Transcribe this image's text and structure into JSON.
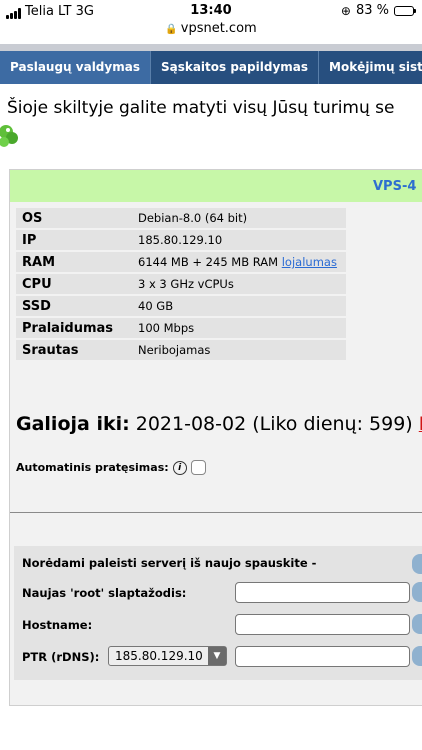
{
  "status_bar": {
    "carrier": "Telia LT 3G",
    "time": "13:40",
    "battery": "83 %",
    "battery_level": 0.83,
    "url": "vpsnet.com"
  },
  "nav": {
    "tabs": [
      {
        "label": "Paslaugų valdymas"
      },
      {
        "label": "Sąskaitos papildymas"
      },
      {
        "label": "Mokėjimų siste"
      }
    ]
  },
  "intro_text": "Šioje skiltyje galite matyti visų Jūsų turimų se",
  "vps": {
    "title": "VPS-4",
    "specs": [
      {
        "key": "OS",
        "value": "Debian-8.0 (64 bit)"
      },
      {
        "key": "IP",
        "value": "185.80.129.10"
      },
      {
        "key": "RAM",
        "value": "6144 MB + 245 MB RAM ",
        "link": "lojalumas"
      },
      {
        "key": "CPU",
        "value": "3 x 3 GHz vCPUs"
      },
      {
        "key": "SSD",
        "value": "40 GB"
      },
      {
        "key": "Pralaidumas",
        "value": "100 Mbps"
      },
      {
        "key": "Srautas",
        "value": "Neribojamas"
      }
    ],
    "valid_label": "Galioja iki:",
    "valid_value": "2021-08-02 (Liko dienų: 599)",
    "valid_action": "Pr",
    "auto_renew_label": "Automatinis pratęsimas:"
  },
  "reinstall": {
    "heading": "Norėdami paleisti serverį iš naujo spauskite -",
    "root_label": "Naujas 'root' slaptažodis:",
    "hostname_label": "Hostname:",
    "ptr_label": "PTR (rDNS):",
    "ptr_selected": "185.80.129.10"
  },
  "colors": {
    "panel_header": "#c7f7a8",
    "tab_active": "#3d6ba3",
    "tab_other": "#274f7f",
    "link": "#2a6bd4",
    "alert": "#d21414"
  }
}
